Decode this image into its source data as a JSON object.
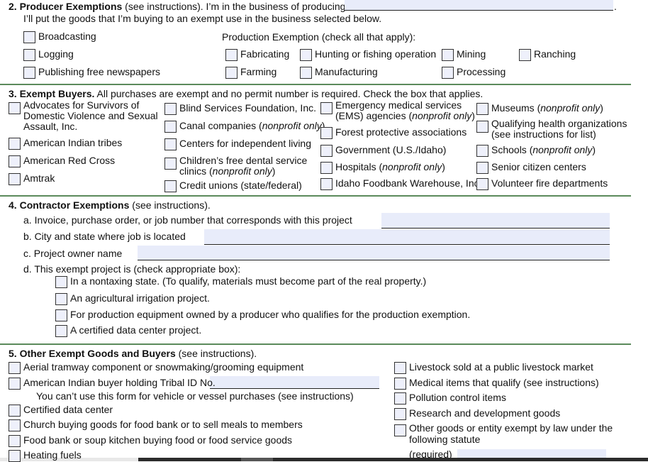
{
  "s2": {
    "num": "2.",
    "title": "Producer Exemptions",
    "title_rest": " (see instructions). I’m in the business of producing",
    "period": ".",
    "line2": "I’ll put the goods that I’m buying to an exempt use in the business selected below.",
    "prod_heading": "Production Exemption (check all that apply):",
    "items": [
      [
        {
          "t": "Broadcasting"
        }
      ],
      [
        {
          "t": "Logging"
        }
      ],
      [
        {
          "t": "Publishing free newspapers"
        }
      ],
      [
        {
          "t": "Fabricating"
        }
      ],
      [
        {
          "t": "Hunting or fishing operation"
        }
      ],
      [
        {
          "t": "Mining"
        }
      ],
      [
        {
          "t": "Ranching"
        }
      ],
      [
        {
          "t": "Farming"
        }
      ],
      [
        {
          "t": "Manufacturing"
        }
      ],
      [
        {
          "t": "Processing"
        }
      ]
    ]
  },
  "s3": {
    "num": "3.",
    "title": "Exempt Buyers.",
    "title_rest": " All purchases are exempt and no permit number is required. Check the box that applies.",
    "items": [
      [
        {
          "t": "Advocates for Survivors of"
        },
        {
          "br": 1
        },
        {
          "t": "Domestic Violence and Sexual"
        },
        {
          "br": 1
        },
        {
          "t": "Assault, Inc."
        }
      ],
      [
        {
          "t": "American Indian tribes"
        }
      ],
      [
        {
          "t": "American Red Cross"
        }
      ],
      [
        {
          "t": "Amtrak"
        }
      ],
      [
        {
          "t": "Blind Services Foundation, Inc."
        }
      ],
      [
        {
          "t": "Canal companies ("
        },
        {
          "t": "nonprofit only",
          "i": 1
        },
        {
          "t": ")"
        }
      ],
      [
        {
          "t": "Centers for independent living"
        }
      ],
      [
        {
          "t": "Children’s free dental service"
        },
        {
          "br": 1
        },
        {
          "t": "clinics ("
        },
        {
          "t": "nonprofit only",
          "i": 1
        },
        {
          "t": ")"
        }
      ],
      [
        {
          "t": "Credit unions (state/federal)"
        }
      ],
      [
        {
          "t": "Emergency medical services"
        },
        {
          "br": 1
        },
        {
          "t": "(EMS) agencies ("
        },
        {
          "t": "nonprofit only",
          "i": 1
        },
        {
          "t": ")"
        }
      ],
      [
        {
          "t": "Forest protective associations"
        }
      ],
      [
        {
          "t": "Government (U.S./Idaho)"
        }
      ],
      [
        {
          "t": "Hospitals ("
        },
        {
          "t": "nonprofit only",
          "i": 1
        },
        {
          "t": ")"
        }
      ],
      [
        {
          "t": "Idaho Foodbank Warehouse, Inc."
        }
      ],
      [
        {
          "t": "Museums ("
        },
        {
          "t": "nonprofit only",
          "i": 1
        },
        {
          "t": ")"
        }
      ],
      [
        {
          "t": "Qualifying health organizations"
        },
        {
          "br": 1
        },
        {
          "t": "(see instructions for list)"
        }
      ],
      [
        {
          "t": "Schools ("
        },
        {
          "t": "nonprofit only",
          "i": 1
        },
        {
          "t": ")"
        }
      ],
      [
        {
          "t": "Senior citizen centers"
        }
      ],
      [
        {
          "t": "Volunteer fire departments"
        }
      ]
    ]
  },
  "s4": {
    "num": "4.",
    "title": "Contractor Exemptions",
    "title_rest": " (see instructions).",
    "a": "a.  Invoice, purchase order, or job number that corresponds with this project",
    "b": "b.  City and state where job is located",
    "c": "c.  Project owner name",
    "d": "d.  This exempt project is (check appropriate box):",
    "fields": {
      "a": "",
      "b": "",
      "c": ""
    },
    "items": [
      [
        {
          "t": "In a nontaxing state. (To qualify, materials must become part of the real property.)"
        }
      ],
      [
        {
          "t": "An agricultural irrigation project."
        }
      ],
      [
        {
          "t": "For production equipment owned by a producer who qualifies for the production exemption."
        }
      ],
      [
        {
          "t": "A certified data center project."
        }
      ]
    ]
  },
  "s5": {
    "num": "5.",
    "title": "Other Exempt Goods and Buyers",
    "title_rest": " (see instructions).",
    "note": "You can’t use this form for vehicle or vessel purchases (see instructions)",
    "tribal_id": "",
    "statute": "",
    "required": "(required)",
    "items": [
      [
        {
          "t": "Aerial tramway component or snowmaking/grooming equipment"
        }
      ],
      [
        {
          "t": "American Indian buyer holding Tribal ID No."
        }
      ],
      [
        {
          "t": "Certified data center"
        }
      ],
      [
        {
          "t": "Church buying goods for food bank or to sell meals to members"
        }
      ],
      [
        {
          "t": "Food bank or soup kitchen buying food or food service goods"
        }
      ],
      [
        {
          "t": "Heating fuels"
        }
      ],
      [
        {
          "t": "Livestock sold at a public livestock market"
        }
      ],
      [
        {
          "t": "Medical items that qualify (see instructions)"
        }
      ],
      [
        {
          "t": "Pollution control items"
        }
      ],
      [
        {
          "t": "Research and development goods"
        }
      ],
      [
        {
          "t": "Other goods or entity exempt by law under the"
        },
        {
          "br": 1
        },
        {
          "t": "following statute"
        }
      ]
    ]
  },
  "colors": {
    "rule": "#5b8a5b",
    "field": "#e8ecfa",
    "checkbox": "#eef0fb"
  }
}
